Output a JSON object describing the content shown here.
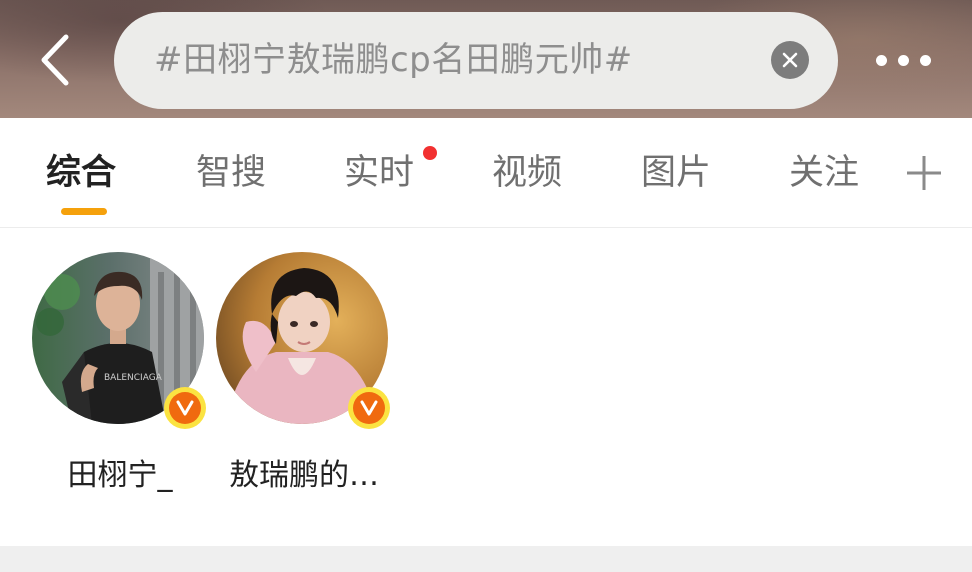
{
  "header": {
    "search_query": "#田栩宁敖瑞鹏cp名田鹏元帅#",
    "back_icon": "chevron-left-icon",
    "clear_icon": "close-circle-icon",
    "more_icon": "more-horizontal-icon"
  },
  "tabs": [
    {
      "label": "综合",
      "active": true
    },
    {
      "label": "智搜",
      "active": false
    },
    {
      "label": "实时",
      "active": false,
      "badge": "red-dot"
    },
    {
      "label": "视频",
      "active": false
    },
    {
      "label": "图片",
      "active": false
    },
    {
      "label": "关注",
      "active": false
    }
  ],
  "tab_add_icon": "plus-icon",
  "users": [
    {
      "name": "田栩宁_",
      "verified": true
    },
    {
      "name": "敖瑞鹏的…",
      "verified": true
    }
  ],
  "colors": {
    "accent": "#f5a10c",
    "notification": "#f23030",
    "verify_badge": "#f06a0f"
  }
}
